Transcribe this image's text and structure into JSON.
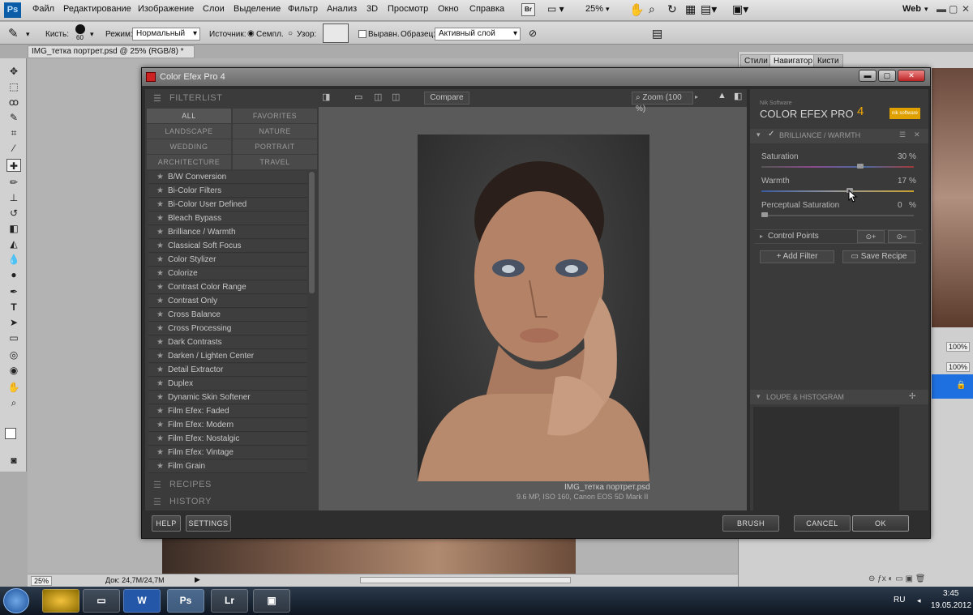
{
  "menu": {
    "logo": "Ps",
    "items": [
      "Файл",
      "Редактирование",
      "Изображение",
      "Слои",
      "Выделение",
      "Фильтр",
      "Анализ",
      "3D",
      "Просмотр",
      "Окно",
      "Справка"
    ],
    "zoom": "25%",
    "workspace": "Web"
  },
  "options": {
    "brush_label": "Кисть:",
    "brush_size": "60",
    "mode_label": "Режим:",
    "mode_value": "Нормальный",
    "source_label": "Источник:",
    "source_opt1": "Семпл.",
    "source_opt2": "Узор:",
    "align_label": "Выравн.",
    "sample_label": "Образец:",
    "sample_value": "Активный слой"
  },
  "document": {
    "tab_title": "IMG_тетка портрет.psd @ 25% (RGB/8) *",
    "status_zoom": "25%",
    "status_doc": "Док: 24,7M/24,7M"
  },
  "right_panel": {
    "tabs": [
      "Стили",
      "Навигатор",
      "Кисти"
    ],
    "pct1": "100%",
    "pct2": "100%"
  },
  "dialog": {
    "title": "Color Efex Pro 4",
    "filterlist_header": "FILTERLIST",
    "categories": [
      "ALL",
      "FAVORITES",
      "LANDSCAPE",
      "NATURE",
      "WEDDING",
      "PORTRAIT",
      "ARCHITECTURE",
      "TRAVEL"
    ],
    "filters": [
      "B/W Conversion",
      "Bi-Color Filters",
      "Bi-Color User Defined",
      "Bleach Bypass",
      "Brilliance / Warmth",
      "Classical Soft Focus",
      "Color Stylizer",
      "Colorize",
      "Contrast Color Range",
      "Contrast Only",
      "Cross Balance",
      "Cross Processing",
      "Dark Contrasts",
      "Darken / Lighten Center",
      "Detail Extractor",
      "Duplex",
      "Dynamic Skin Softener",
      "Film Efex: Faded",
      "Film Efex: Modern",
      "Film Efex: Nostalgic",
      "Film Efex: Vintage",
      "Film Grain"
    ],
    "recipes_header": "RECIPES",
    "history_header": "HISTORY",
    "compare_label": "Compare",
    "zoom_label": "Zoom (100 %)",
    "image_name": "IMG_тетка портрет.psd",
    "image_info": "9.6 MP, ISO 160, Canon EOS 5D Mark II",
    "brand_small": "Nik Software",
    "brand_name": "COLOR EFEX PRO",
    "brand_version": "4",
    "brand_badge": "nik software",
    "active_filter": "BRILLIANCE / WARMTH",
    "controls": [
      {
        "label": "Saturation",
        "value": "30",
        "unit": "%",
        "level": 0.65
      },
      {
        "label": "Warmth",
        "value": "17",
        "unit": "%",
        "level": 0.58
      },
      {
        "label": "Perceptual Saturation",
        "value": "0",
        "unit": "%",
        "level": 0.02
      }
    ],
    "control_points": "Control Points",
    "add_filter": "Add Filter",
    "save_recipe": "Save Recipe",
    "loupe_header": "LOUPE & HISTOGRAM",
    "help": "HELP",
    "settings": "SETTINGS",
    "brush": "BRUSH",
    "cancel": "CANCEL",
    "ok": "OK"
  },
  "taskbar": {
    "lang": "RU",
    "time": "3:45",
    "date": "19.05.2012",
    "apps": [
      "Ps",
      "Lr"
    ]
  },
  "colors": {
    "accent": "#0c5da8",
    "brand_badge": "#e0a000",
    "selection": "#1e6fe0"
  }
}
